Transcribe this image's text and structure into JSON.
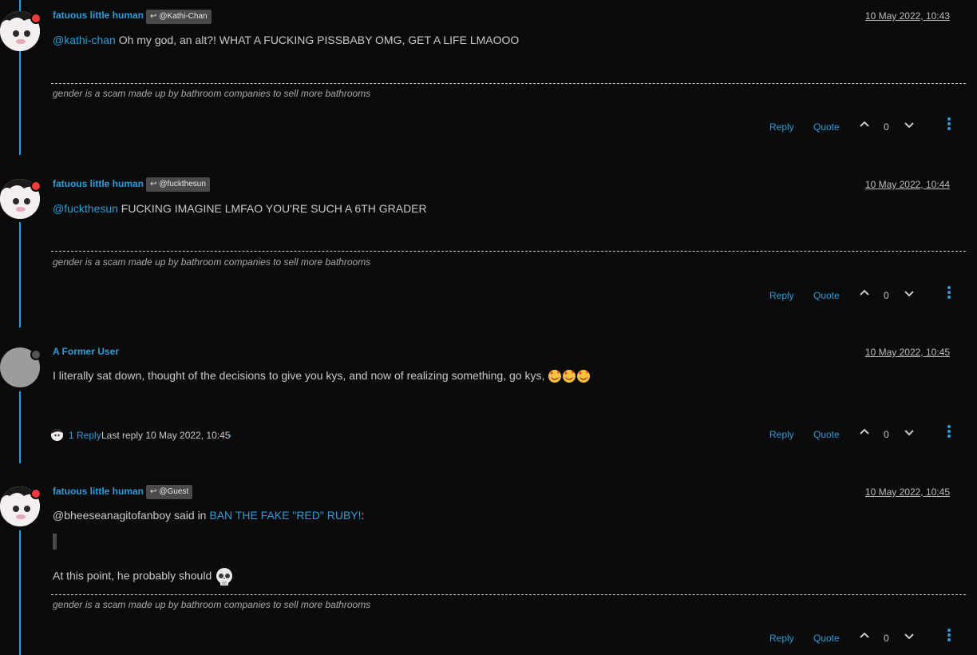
{
  "posts": [
    {
      "username": "fatuous little human",
      "reply_to": "@Kathi-Chan",
      "time": "10 May 2022, 10:43",
      "mention": "@kathi-chan",
      "text": " Oh my god, an alt?! WHAT A FUCKING PISSBABY OMG, GET A LIFE LMAOOO",
      "signature": "gender is a scam made up by bathroom companies to sell more bathrooms",
      "reply_label": "Reply",
      "quote_label": "Quote",
      "votes": "0"
    },
    {
      "username": "fatuous little human",
      "reply_to": "@fuckthesun",
      "time": "10 May 2022, 10:44",
      "mention": "@fuckthesun",
      "text": " FUCKING IMAGINE LMFAO YOU'RE SUCH A 6TH GRADER",
      "signature": "gender is a scam made up by bathroom companies to sell more bathrooms",
      "reply_label": "Reply",
      "quote_label": "Quote",
      "votes": "0"
    },
    {
      "username": "A Former User",
      "time": "10 May 2022, 10:45",
      "text": "I literally sat down, thought of the decisions to give you kys, and now of realizing something, go kys, ",
      "replies_count": "1 Reply",
      "last_reply": "Last reply 10 May 2022, 10:45",
      "reply_label": "Reply",
      "quote_label": "Quote",
      "votes": "0"
    },
    {
      "username": "fatuous little human",
      "reply_to": "@Guest",
      "time": "10 May 2022, 10:45",
      "quote_author": "@bheeseanagitofanboy said in ",
      "quote_link": "BAN THE FAKE \"RED\" RUBY!",
      "quote_colon": ":",
      "text": "At this point, he probably should ",
      "signature": "gender is a scam made up by bathroom companies to sell more bathrooms",
      "reply_label": "Reply",
      "quote_label": "Quote",
      "votes": "0"
    }
  ],
  "icons": {
    "reply_to": "reply-arrow-icon",
    "upvote": "chevron-up-icon",
    "downvote": "chevron-down-icon",
    "more": "vertical-dots-icon",
    "replies_expand": "chevron-right-icon",
    "emoji_heart_face": "smiling-face-with-hearts-icon",
    "emoji_skull": "skull-icon"
  },
  "colors": {
    "background": "#0b0b0c",
    "accent": "#2f9bd6",
    "online": "#ef3b3b"
  }
}
